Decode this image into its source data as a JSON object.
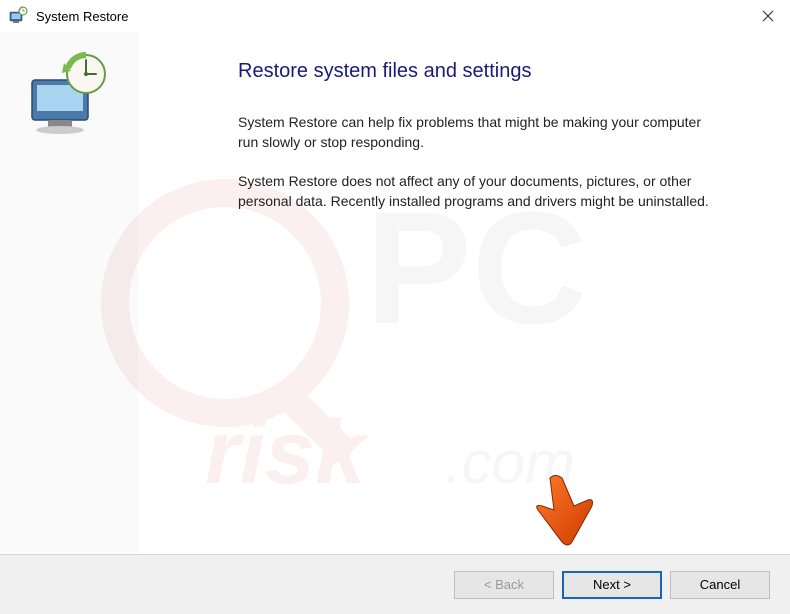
{
  "titlebar": {
    "title": "System Restore"
  },
  "content": {
    "heading": "Restore system files and settings",
    "para1": "System Restore can help fix problems that might be making your computer run slowly or stop responding.",
    "para2": "System Restore does not affect any of your documents, pictures, or other personal data. Recently installed programs and drivers might be uninstalled."
  },
  "footer": {
    "back": "< Back",
    "next": "Next >",
    "cancel": "Cancel"
  }
}
